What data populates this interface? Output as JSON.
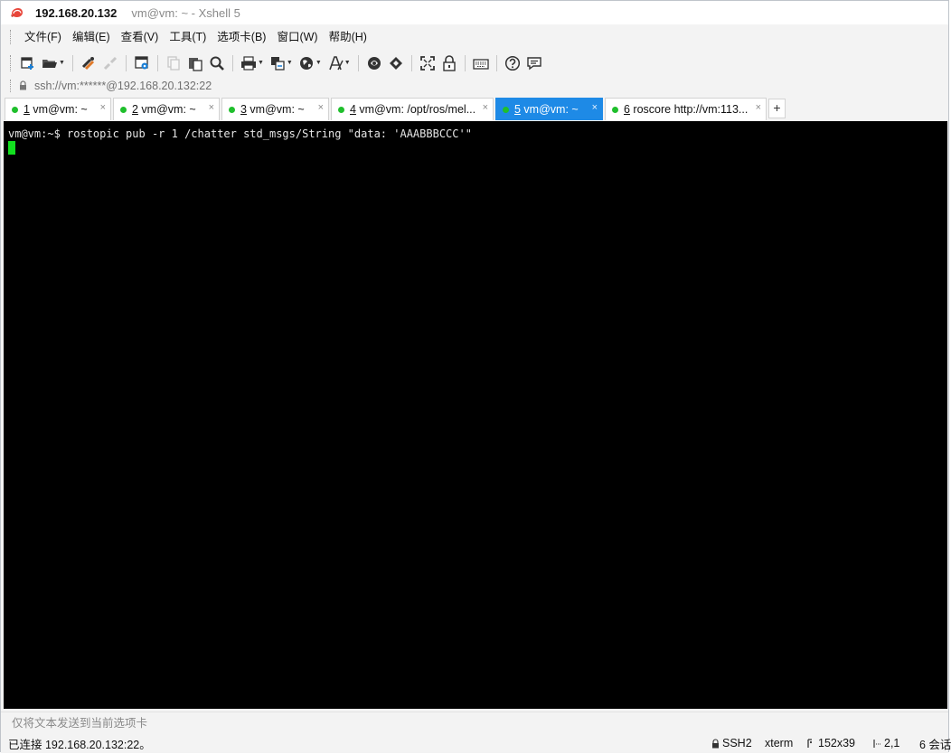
{
  "titlebar": {
    "host": "192.168.20.132",
    "subtitle": "vm@vm: ~ - Xshell 5"
  },
  "menu": {
    "items": [
      "文件(F)",
      "编辑(E)",
      "查看(V)",
      "工具(T)",
      "选项卡(B)",
      "窗口(W)",
      "帮助(H)"
    ]
  },
  "toolbar": {
    "buttons": [
      "new-session-icon",
      "open-folder-icon",
      "reconnect-icon",
      "disconnect-icon",
      "properties-icon",
      "copy-icon",
      "paste-icon",
      "find-icon",
      "print-icon",
      "transfer-icon",
      "globe-icon",
      "font-icon",
      "xftp-icon",
      "xmanager-icon",
      "fullscreen-icon",
      "lock-icon",
      "keyboard-icon",
      "help-icon",
      "chat-icon"
    ]
  },
  "address": {
    "text": "ssh://vm:******@192.168.20.132:22"
  },
  "tabs": [
    {
      "num": "1",
      "label": " vm@vm: ~",
      "active": false
    },
    {
      "num": "2",
      "label": " vm@vm: ~",
      "active": false
    },
    {
      "num": "3",
      "label": " vm@vm: ~",
      "active": false
    },
    {
      "num": "4",
      "label": " vm@vm: /opt/ros/mel...",
      "active": false
    },
    {
      "num": "5",
      "label": " vm@vm: ~",
      "active": true
    },
    {
      "num": "6",
      "label": " roscore http://vm:113...",
      "active": false
    }
  ],
  "tab_close_glyph": "×",
  "tab_add_glyph": "+",
  "terminal": {
    "lines": [
      "vm@vm:~$ rostopic pub -r 1 /chatter std_msgs/String \"data: 'AAABBBCCC'\""
    ]
  },
  "compose": {
    "placeholder": "仅将文本发送到当前选项卡"
  },
  "status": {
    "connection": "已连接 192.168.20.132:22。",
    "protocol": "SSH2",
    "terminal_type": "xterm",
    "size": "152x39",
    "position": "2,1",
    "sessions": "6 会话"
  },
  "colors": {
    "active_tab": "#1e8ae6",
    "status_dot": "#1fbf2c",
    "cursor": "#12e01f",
    "terminal_bg": "#000000"
  }
}
